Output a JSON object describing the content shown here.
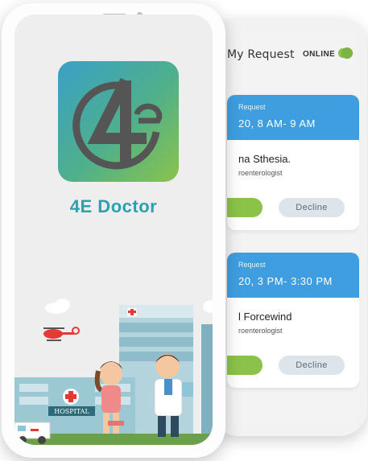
{
  "splash": {
    "app_name": "4E Doctor",
    "logo_glyph": "4e-logo",
    "hospital_sign": "HOSPITAL"
  },
  "requests_screen": {
    "title": "My Request",
    "online_label": "ONLINE",
    "online_enabled": true,
    "cards": [
      {
        "label": "Request",
        "time": "20, 8 AM- 9 AM",
        "name": "na Sthesia.",
        "specialty": "roenterologist",
        "decline_label": "Decline"
      },
      {
        "label": "Request",
        "time": "20, 3 PM- 3:30 PM",
        "name": "l Forcewind",
        "specialty": "roenterologist",
        "decline_label": "Decline"
      }
    ]
  },
  "colors": {
    "accent_blue": "#3f9ee0",
    "accent_green": "#8bc34a",
    "brand_teal": "#2aa0b0"
  }
}
